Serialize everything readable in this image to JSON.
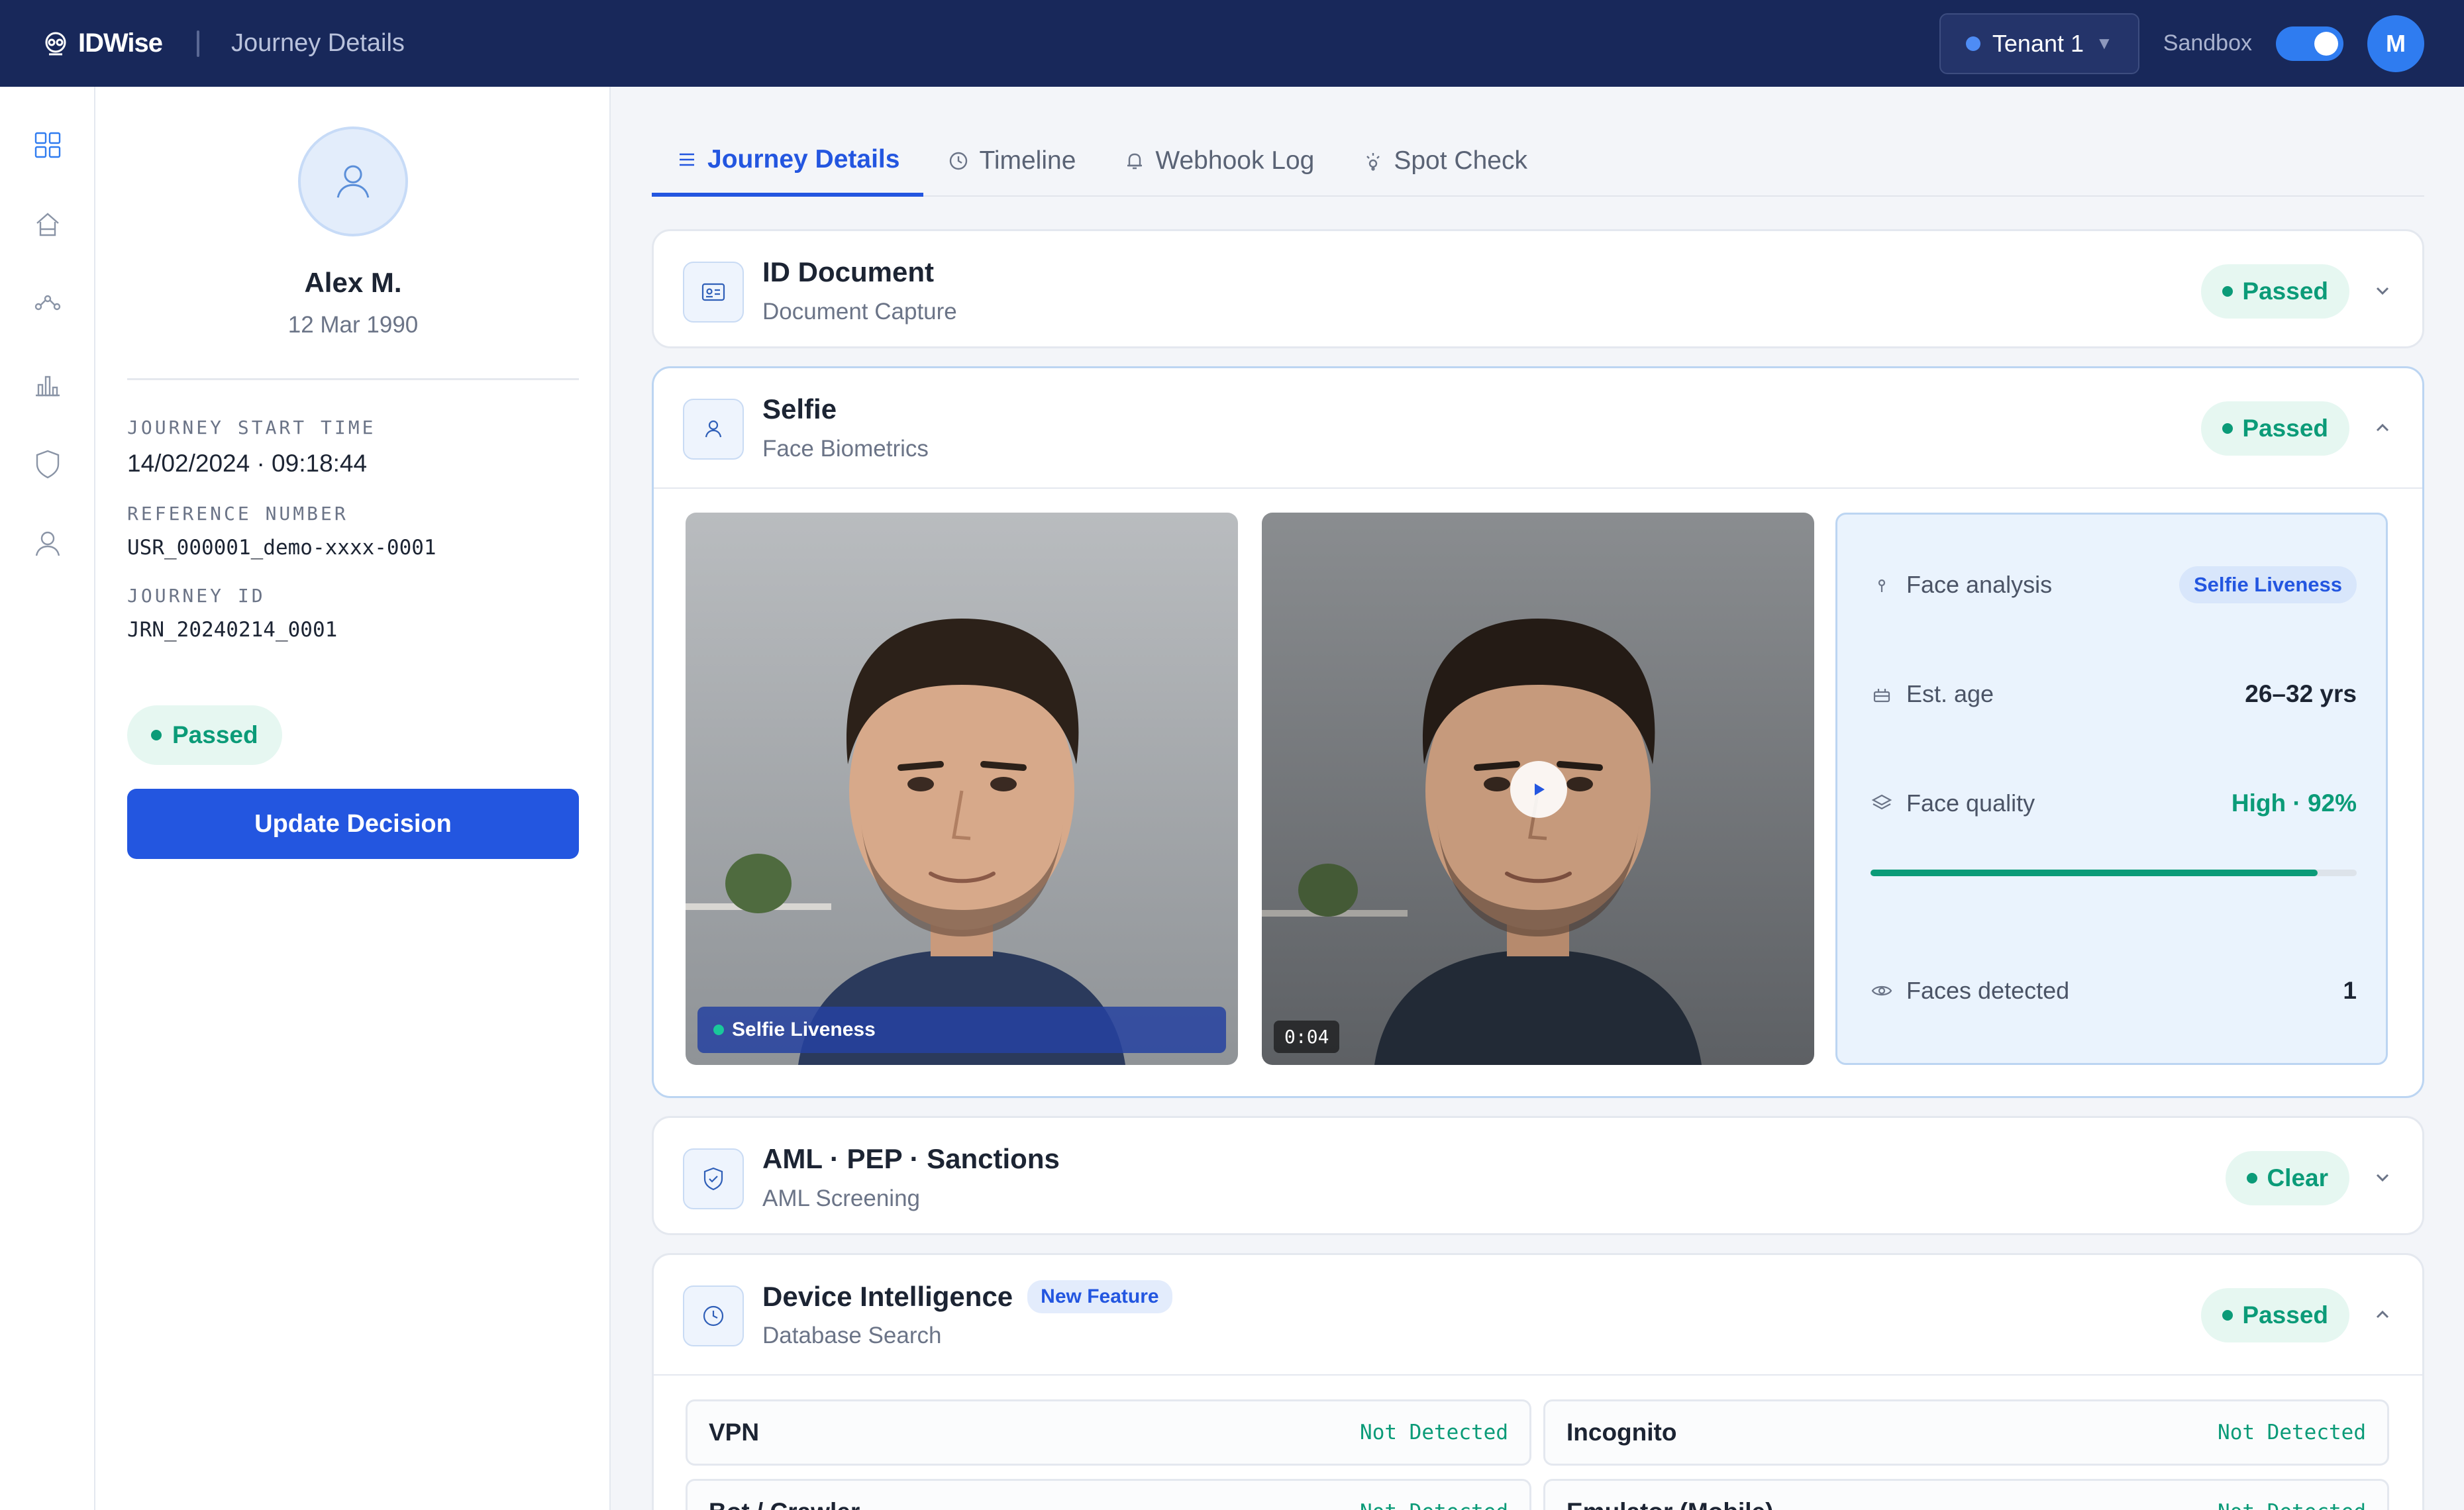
{
  "header": {
    "brand": "IDWise",
    "page_title": "Journey Details",
    "tenant": "Tenant 1",
    "sandbox_label": "Sandbox",
    "sandbox_on": true,
    "user_initial": "M"
  },
  "rail": {
    "items": [
      "dashboard-icon",
      "home-icon",
      "flow-icon",
      "chart-icon",
      "shield-icon",
      "user-icon"
    ],
    "active": "dashboard-icon"
  },
  "profile": {
    "name": "Alex M.",
    "dob": "12 Mar 1990",
    "fields": [
      {
        "label": "JOURNEY START TIME",
        "value": "14/02/2024 · 09:18:44"
      },
      {
        "label": "REFERENCE NUMBER",
        "value": "USR_000001_demo-xxxx-0001"
      },
      {
        "label": "JOURNEY ID",
        "value": "JRN_20240214_0001"
      }
    ],
    "status": "Passed",
    "update_button": "Update Decision"
  },
  "tabs": [
    {
      "label": "Journey Details",
      "icon": "list-icon",
      "active": true
    },
    {
      "label": "Timeline",
      "icon": "clock-icon",
      "active": false
    },
    {
      "label": "Webhook Log",
      "icon": "bell-icon",
      "active": false
    },
    {
      "label": "Spot Check",
      "icon": "sparkle-icon",
      "active": false
    }
  ],
  "cards": {
    "id_document": {
      "title": "ID Document",
      "subtitle": "Document Capture",
      "status": "Passed"
    },
    "selfie": {
      "title": "Selfie",
      "subtitle": "Face Biometrics",
      "status": "Passed",
      "photo_tag": "Selfie Liveness",
      "video_duration": "0:04",
      "analysis": {
        "face_analysis_label": "Face analysis",
        "face_analysis_tag": "Selfie Liveness",
        "age_label": "Est. age",
        "age_value": "26–32 yrs",
        "quality_label": "Face quality",
        "quality_value": "High · 92%",
        "quality_fraction": 0.92,
        "faces_label": "Faces detected",
        "faces_value": "1"
      }
    },
    "aml": {
      "title": "AML · PEP · Sanctions",
      "subtitle": "AML Screening",
      "status": "Clear"
    },
    "device": {
      "title": "Device Intelligence",
      "badge": "New Feature",
      "subtitle": "Database Search",
      "status": "Passed",
      "checks": [
        {
          "name": "VPN",
          "value": "Not Detected"
        },
        {
          "name": "Incognito",
          "value": "Not Detected"
        },
        {
          "name": "Bot / Crawler",
          "value": "Not Detected"
        },
        {
          "name": "Emulator (Mobile)",
          "value": "Not Detected"
        }
      ]
    }
  },
  "colors": {
    "header_bg": "#18285a",
    "accent": "#2356e0",
    "success": "#0b9b78"
  }
}
